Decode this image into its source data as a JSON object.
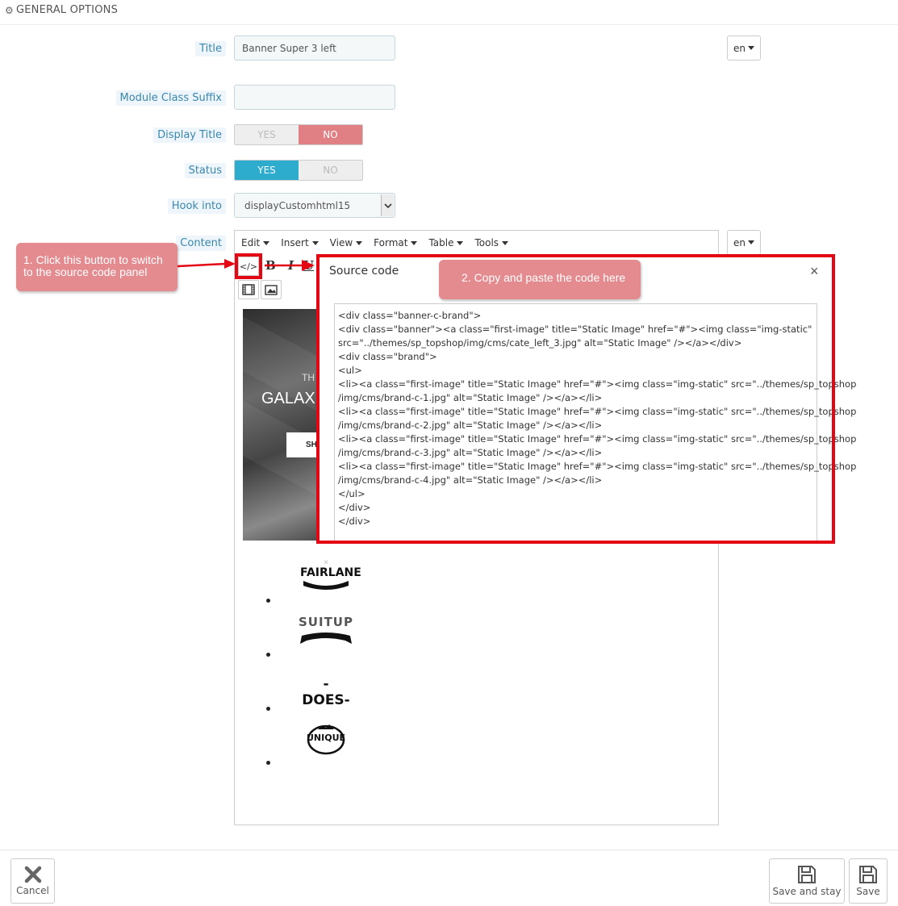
{
  "section": {
    "title": "GENERAL OPTIONS",
    "icon": "gears-icon"
  },
  "form": {
    "title": {
      "label": "Title",
      "value": "Banner Super 3 left",
      "lang": "en"
    },
    "module_class_suffix": {
      "label": "Module Class Suffix",
      "value": ""
    },
    "display_title": {
      "label": "Display Title",
      "yes": "YES",
      "no": "NO",
      "selected": "NO"
    },
    "status": {
      "label": "Status",
      "yes": "YES",
      "no": "NO",
      "selected": "YES"
    },
    "hook_into": {
      "label": "Hook into",
      "value": "displayCustomhtml15"
    },
    "content": {
      "label": "Content",
      "lang": "en"
    }
  },
  "editor": {
    "menu": [
      "Edit",
      "Insert",
      "View",
      "Format",
      "Table",
      "Tools"
    ],
    "toolbar": {
      "source_code": "</>",
      "bold": "B",
      "italic": "I",
      "underline": "U"
    },
    "preview": {
      "banner_text_small": "TH",
      "banner_text_big": "GALAX",
      "banner_button": "SH",
      "brands": [
        "FAIRLANE",
        "SUITUP",
        "-DOES-",
        "UNIQUE"
      ]
    }
  },
  "source_dialog": {
    "title": "Source code",
    "close": "×",
    "code_lines": [
      "<div class=\"banner-c-brand\">",
      "<div class=\"banner\"><a class=\"first-image\" title=\"Static Image\" href=\"#\"><img class=\"img-static\"",
      "src=\"../themes/sp_topshop/img/cms/cate_left_3.jpg\" alt=\"Static Image\" /></a></div>",
      "<div class=\"brand\">",
      "<ul>",
      "<li><a class=\"first-image\" title=\"Static Image\" href=\"#\"><img class=\"img-static\" src=\"../themes/sp_topshop",
      "/img/cms/brand-c-1.jpg\" alt=\"Static Image\" /></a></li>",
      "<li><a class=\"first-image\" title=\"Static Image\" href=\"#\"><img class=\"img-static\" src=\"../themes/sp_topshop",
      "/img/cms/brand-c-2.jpg\" alt=\"Static Image\" /></a></li>",
      "<li><a class=\"first-image\" title=\"Static Image\" href=\"#\"><img class=\"img-static\" src=\"../themes/sp_topshop",
      "/img/cms/brand-c-3.jpg\" alt=\"Static Image\" /></a></li>",
      "<li><a class=\"first-image\" title=\"Static Image\" href=\"#\"><img class=\"img-static\" src=\"../themes/sp_topshop",
      "/img/cms/brand-c-4.jpg\" alt=\"Static Image\" /></a></li>",
      "</ul>",
      "</div>",
      "</div>"
    ]
  },
  "callouts": {
    "step1": "1. Click this button to switch to the source code panel",
    "step2": "2. Copy and paste the code here"
  },
  "footer": {
    "cancel": "Cancel",
    "save_and_stay": "Save and stay",
    "save": "Save"
  },
  "colors": {
    "accent_blue": "#2eacce",
    "no_red": "#e07f84",
    "callout": "#e38b8f",
    "frame_red": "#e30613"
  }
}
